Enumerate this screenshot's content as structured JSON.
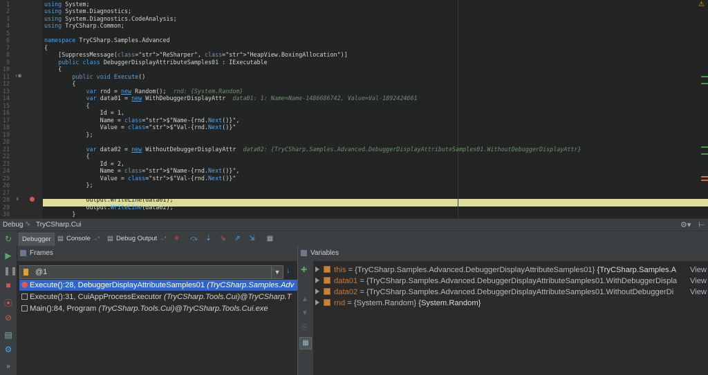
{
  "editor": {
    "lines": [
      {
        "n": "1",
        "t": "using System;"
      },
      {
        "n": "2",
        "t": "using System.Diagnostics;"
      },
      {
        "n": "3",
        "t": "using System.Diagnostics.CodeAnalysis;"
      },
      {
        "n": "4",
        "t": "using TryCSharp.Common;"
      },
      {
        "n": "5",
        "t": ""
      },
      {
        "n": "6",
        "t": "namespace TryCSharp.Samples.Advanced"
      },
      {
        "n": "7",
        "t": "{"
      },
      {
        "n": "8",
        "t": "    [SuppressMessage(\"ReSharper\", \"HeapView.BoxingAllocation\")]"
      },
      {
        "n": "9",
        "t": "    public class DebuggerDisplayAttributeSamples01 : IExecutable"
      },
      {
        "n": "10",
        "t": "    {"
      },
      {
        "n": "11",
        "t": "        public void Execute()"
      },
      {
        "n": "12",
        "t": "        {"
      },
      {
        "n": "13",
        "t": "            var rnd = new Random();"
      },
      {
        "n": "14",
        "t": "            var data01 = new WithDebuggerDisplayAttr"
      },
      {
        "n": "15",
        "t": "            {"
      },
      {
        "n": "16",
        "t": "                Id = 1,"
      },
      {
        "n": "17",
        "t": "                Name = $\"Name-{rnd.Next()}\","
      },
      {
        "n": "18",
        "t": "                Value = $\"Val-{rnd.Next()}\""
      },
      {
        "n": "19",
        "t": "            };"
      },
      {
        "n": "20",
        "t": ""
      },
      {
        "n": "21",
        "t": "            var data02 = new WithoutDebuggerDisplayAttr"
      },
      {
        "n": "22",
        "t": "            {"
      },
      {
        "n": "23",
        "t": "                Id = 2,"
      },
      {
        "n": "24",
        "t": "                Name = $\"Name-{rnd.Next()}\","
      },
      {
        "n": "25",
        "t": "                Value = $\"Val-{rnd.Next()}\""
      },
      {
        "n": "26",
        "t": "            };"
      },
      {
        "n": "27",
        "t": ""
      },
      {
        "n": "28",
        "t": "            Output.WriteLine(data01);"
      },
      {
        "n": "29",
        "t": "            Output.WriteLine(data02);"
      },
      {
        "n": "30",
        "t": "        }"
      }
    ],
    "hints": {
      "rnd": "rnd: {System.Random}",
      "data01": "data01: 1: Name=Name-1486686742, Value=Val-1892424661",
      "data02": "data02: {TryCSharp.Samples.Advanced.DebuggerDisplayAttributeSamples01.WithoutDebuggerDisplayAttr}"
    },
    "gutter_marker_11": "↑⊕"
  },
  "debugbar": {
    "label": "Debug",
    "config": "TryCSharp.Cui"
  },
  "tabs": [
    {
      "label": "Debugger"
    },
    {
      "label": "Console"
    },
    {
      "label": "Debug Output"
    }
  ],
  "frames": {
    "header": "Frames",
    "thread": "@1",
    "items": [
      {
        "main": "Execute():28, DebuggerDisplayAttributeSamples01 ",
        "italic": "(TryCSharp.Samples.Adv"
      },
      {
        "main": "Execute():31, CuiAppProcessExecutor ",
        "italic": "(TryCSharp.Tools.Cui)@TryCSharp.T"
      },
      {
        "main": "Main():84, Program ",
        "italic": "(TryCSharp.Tools.Cui)@TryCSharp.Tools.Cui.exe"
      }
    ]
  },
  "variables": {
    "header": "Variables",
    "items": [
      {
        "name": "this",
        "value": " = {TryCSharp.Samples.Advanced.DebuggerDisplayAttributeSamples01} ",
        "type": "{TryCSharp.Samples.A",
        "view": "View"
      },
      {
        "name": "data01",
        "value": " = {TryCSharp.Samples.Advanced.DebuggerDisplayAttributeSamples01.WithDebuggerDispla",
        "type": "",
        "view": "View"
      },
      {
        "name": "data02",
        "value": " = {TryCSharp.Samples.Advanced.DebuggerDisplayAttributeSamples01.WithoutDebuggerDi",
        "type": "",
        "view": "View"
      },
      {
        "name": "rnd",
        "value": " = {System.Random} ",
        "type": "{System.Random}",
        "view": ""
      }
    ]
  }
}
